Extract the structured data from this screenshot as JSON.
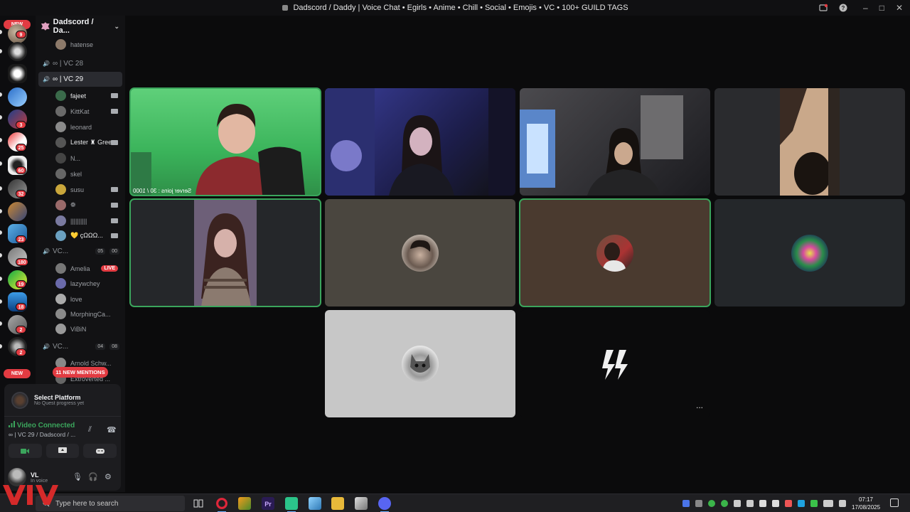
{
  "window": {
    "title": "Dadscord / Daddy | Voice Chat • Egirls • Anime • Chill • Social • Emojis • VC • 100+ GUILD TAGS",
    "controls": [
      "minimize-icon",
      "maximize-icon",
      "close-icon"
    ]
  },
  "rail": {
    "new_top": "NEW",
    "new_bottom": "NEW",
    "badges": [
      "9",
      "3",
      "25",
      "60",
      "32",
      "23",
      "180",
      "19",
      "18",
      "2",
      "2"
    ]
  },
  "sidebar": {
    "server_name": "Dadscord / Da...",
    "rows": [
      {
        "type": "user",
        "name": "hatense"
      },
      {
        "type": "vc",
        "name": "∞ | VC 28"
      },
      {
        "type": "vc",
        "name": "∞ | VC 29",
        "active": true
      },
      {
        "type": "user",
        "name": "fajeet",
        "cam": true,
        "bright": true
      },
      {
        "type": "user",
        "name": "KittKat",
        "cam": true
      },
      {
        "type": "user",
        "name": "leonard"
      },
      {
        "type": "user",
        "name": "Lester ♜ Gree...",
        "cam": true,
        "bright": true
      },
      {
        "type": "user",
        "name": "N..."
      },
      {
        "type": "user",
        "name": "skel"
      },
      {
        "type": "user",
        "name": "susu",
        "cam": true
      },
      {
        "type": "user",
        "name": "❁",
        "cam": true
      },
      {
        "type": "user",
        "name": "||||||||||",
        "cam": true
      },
      {
        "type": "user",
        "name": "💛 çΩΩΩ...",
        "cam": true,
        "bright": true
      },
      {
        "type": "vc",
        "name": "VC...",
        "counts": [
          "05",
          "00"
        ]
      },
      {
        "type": "user",
        "name": "Amelia",
        "live": "LIVE"
      },
      {
        "type": "user",
        "name": "lazywchey"
      },
      {
        "type": "user",
        "name": "love"
      },
      {
        "type": "user",
        "name": "MorphingCa..."
      },
      {
        "type": "user",
        "name": "ViBiN"
      },
      {
        "type": "vc",
        "name": "VC...",
        "counts": [
          "04",
          "08"
        ]
      },
      {
        "type": "user",
        "name": "Arnold Schw..."
      },
      {
        "type": "user",
        "name": "Extroverted ..."
      }
    ],
    "mentions_pill": "11 NEW MENTIONS"
  },
  "panel": {
    "quest_title": "Select Platform",
    "quest_sub": "No Quest progress yet",
    "voice_status": "Video Connected",
    "voice_channel": "∞ | VC 29 / Dadscord / ...",
    "user_name": "VL",
    "user_status": "In voice"
  },
  "video": {
    "overlay_text": "Server joins : 30 / 1000",
    "more": "..."
  },
  "taskbar": {
    "search_placeholder": "Type here to search",
    "time": "07:17",
    "date": "17/08/2025"
  },
  "colors": {
    "speaking": "#3ba55c",
    "live": "#e23b42",
    "accent": "#5865f2"
  }
}
